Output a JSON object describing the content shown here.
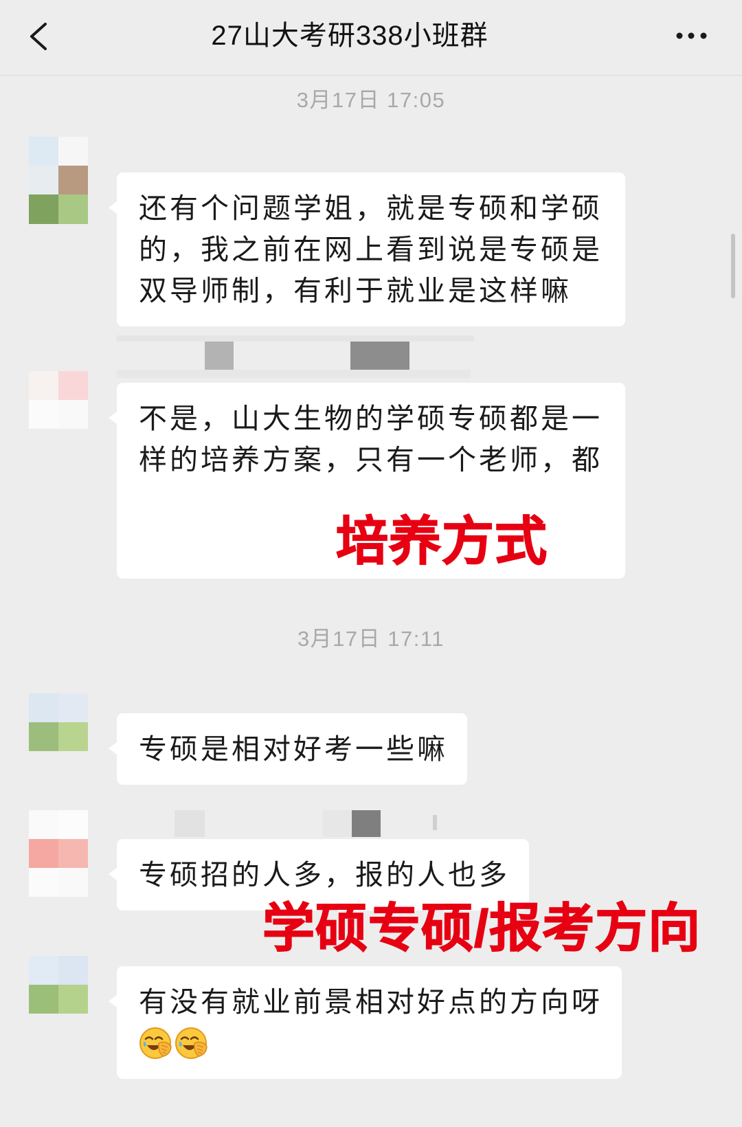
{
  "header": {
    "title": "27山大考研338小班群",
    "back_icon": "chevron-left-icon",
    "more_icon": "more-icon"
  },
  "chat": {
    "timestamps": [
      "3月17日 17:05",
      "3月17日 17:11"
    ],
    "messages": [
      {
        "text": "还有个问题学姐，就是专硕和学硕的，我之前在网上看到说是专硕是双导师制，有利于就业是这样嘛"
      },
      {
        "text": "不是，山大生物的学硕专硕都是一样的培养方案，只有一个老师，都"
      },
      {
        "text": "专硕是相对好考一些嘛"
      },
      {
        "text": "专硕招的人多，报的人也多"
      },
      {
        "text": "有没有就业前景相对好点的方向呀",
        "emojis": [
          "facepalm-emoji",
          "facepalm-emoji"
        ]
      }
    ]
  },
  "annotations": [
    "培养方式",
    "学硕专硕/报考方向"
  ],
  "colors": {
    "background": "#ededed",
    "bubble": "#ffffff",
    "annotation_red": "#e60012",
    "timestamp": "#a8a8a8"
  }
}
